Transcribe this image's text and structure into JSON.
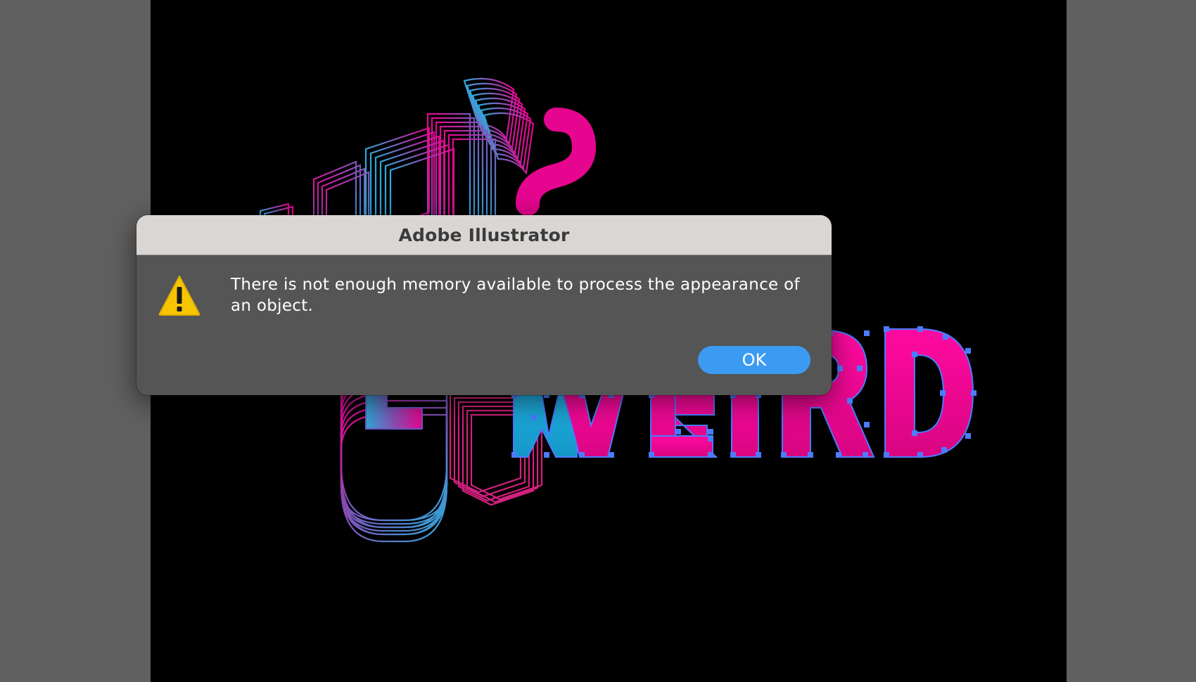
{
  "dialog": {
    "title": "Adobe Illustrator",
    "message": "There is not enough memory available to process the appearance of an object.",
    "ok_label": "OK",
    "icon": "warning-icon",
    "accent": "#3b9bf2"
  },
  "canvas": {
    "artwork_text": "WEIRD",
    "artwork_colors": {
      "magenta": "#e6058f",
      "cyan": "#22a7d8",
      "selection": "#4a7cff"
    }
  }
}
